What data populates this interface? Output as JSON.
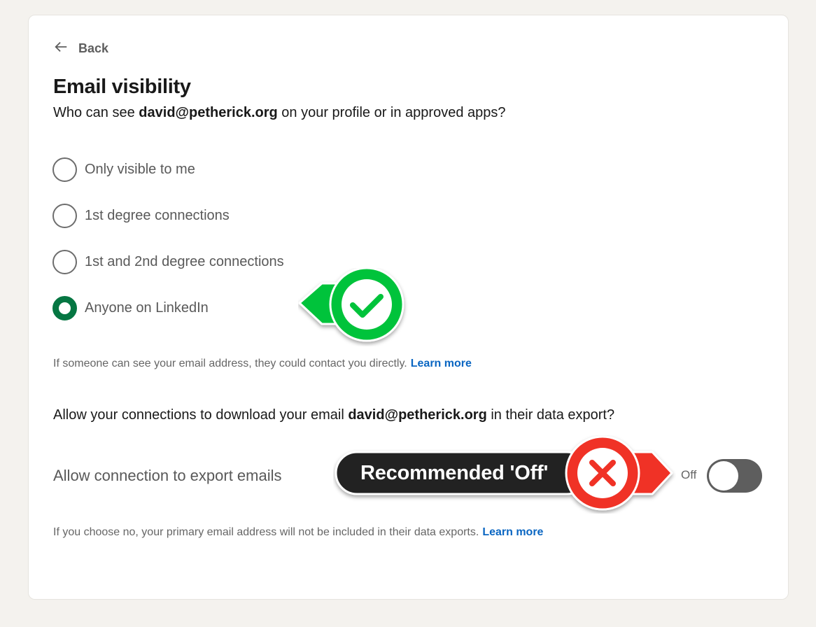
{
  "back_label": "Back",
  "title": "Email visibility",
  "subtitle": {
    "prefix": "Who can see ",
    "email": "david@petherick.org",
    "suffix": " on your profile or in approved apps?"
  },
  "options": [
    {
      "label": "Only visible to me",
      "selected": false
    },
    {
      "label": "1st degree connections",
      "selected": false
    },
    {
      "label": "1st and 2nd degree connections",
      "selected": false
    },
    {
      "label": "Anyone on LinkedIn",
      "selected": true
    }
  ],
  "visibility_hint": {
    "text": "If someone can see your email address, they could contact you directly.",
    "link": "Learn more"
  },
  "export_question": {
    "prefix": "Allow your connections to download your email ",
    "email": "david@petherick.org",
    "suffix": " in their data export?"
  },
  "export_toggle": {
    "label": "Allow connection to export emails",
    "state_label": "Off",
    "on": false
  },
  "export_hint": {
    "text": "If you choose no, your primary email address will not be included in their data exports.",
    "link": "Learn more"
  },
  "annotations": {
    "recommendation": "Recommended 'Off'",
    "check_color": "#00c33b",
    "cross_color": "#f03025"
  },
  "colors": {
    "selected_radio": "#057642",
    "link": "#0a66c2",
    "toggle_off": "#5e5e5e"
  }
}
